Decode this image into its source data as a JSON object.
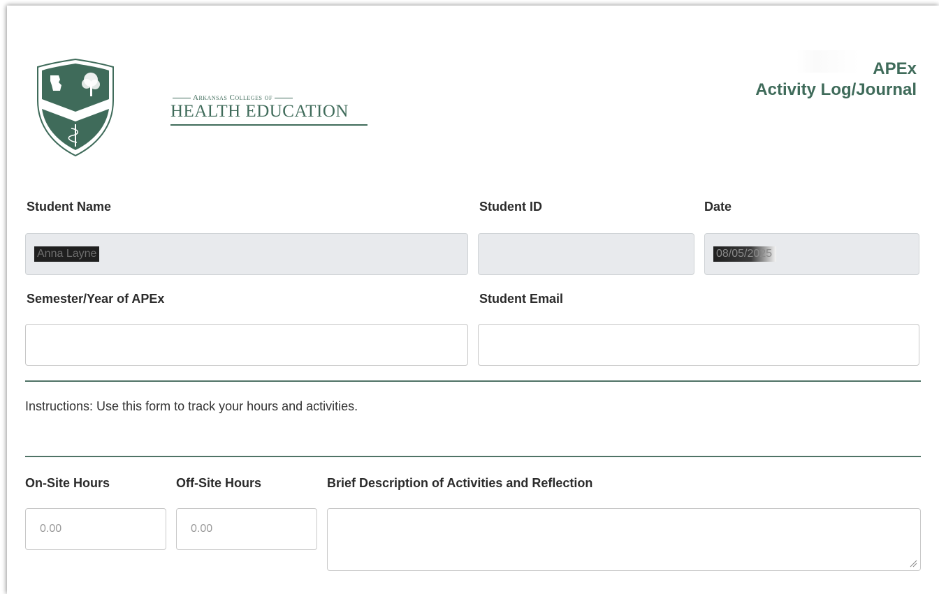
{
  "header": {
    "logo": {
      "tagline": "Arkansas Colleges of",
      "name": "HEALTH EDUCATION"
    },
    "title_line1": "APEx",
    "title_line2": "Activity Log/Journal"
  },
  "form": {
    "student_name": {
      "label": "Student Name",
      "value": "Anna Layne"
    },
    "student_id": {
      "label": "Student ID",
      "value": ""
    },
    "date": {
      "label": "Date",
      "value": "08/05/2025"
    },
    "semester": {
      "label": "Semester/Year of APEx",
      "value": ""
    },
    "email": {
      "label": "Student Email",
      "value": ""
    },
    "instructions": "Instructions: Use this form to track your hours and activities.",
    "onsite": {
      "label": "On-Site Hours",
      "placeholder": "0.00"
    },
    "offsite": {
      "label": "Off-Site Hours",
      "placeholder": "0.00"
    },
    "description": {
      "label": "Brief Description of Activities and Reflection",
      "value": ""
    }
  },
  "colors": {
    "brand_green": "#3f6b5a",
    "divider": "#4f7366",
    "readonly_bg": "#e8eaed"
  }
}
